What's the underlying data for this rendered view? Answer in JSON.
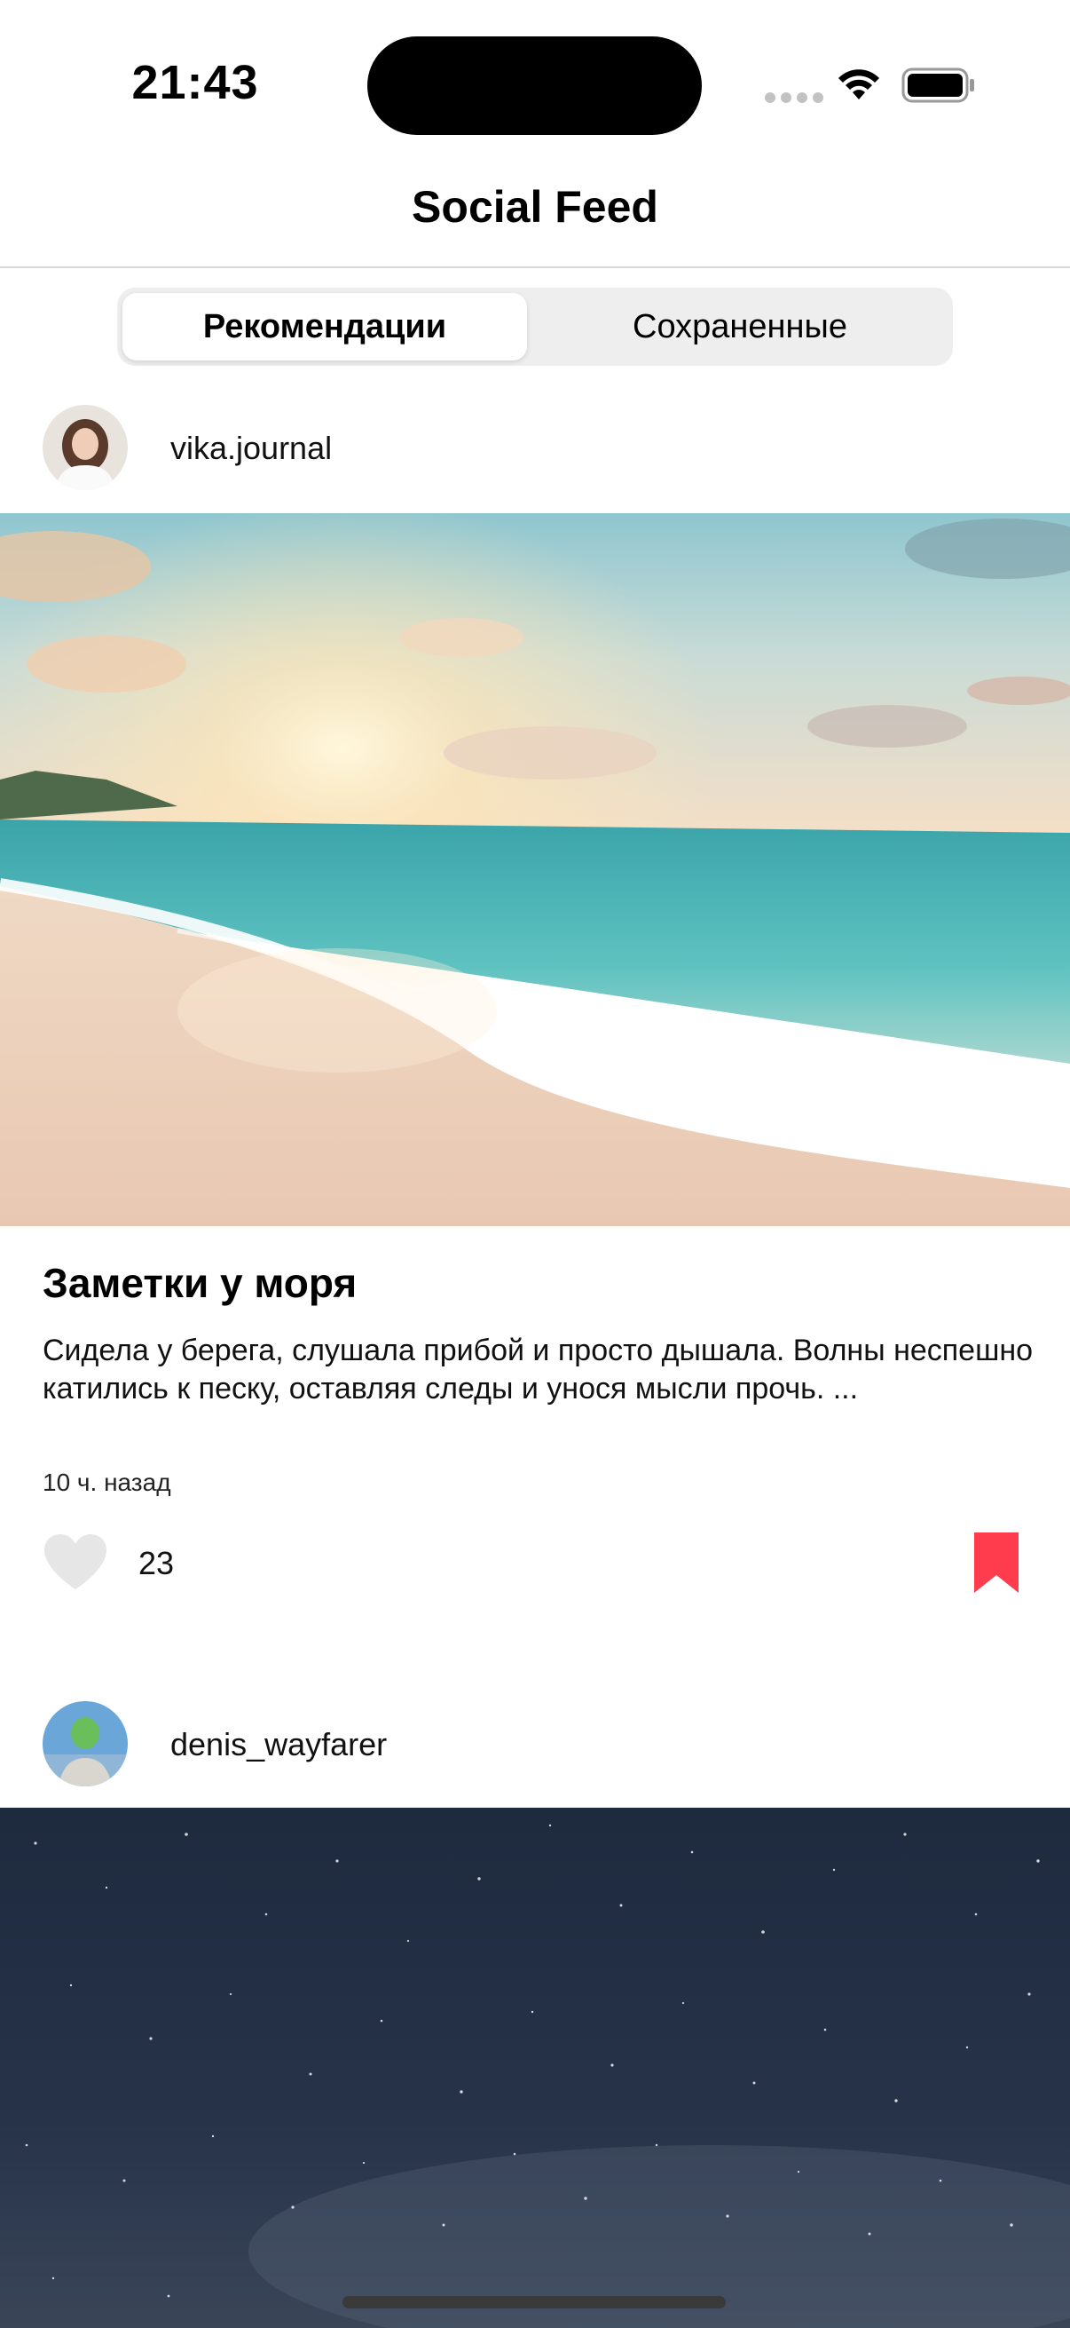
{
  "status_bar": {
    "time": "21:43"
  },
  "nav": {
    "title": "Social Feed"
  },
  "segments": {
    "recommended": "Рекомендации",
    "saved": "Сохраненные",
    "selected": "Рекомендации"
  },
  "posts": [
    {
      "username": "vika.journal",
      "title": "Заметки у моря",
      "text": "Сидела у берега, слушала прибой и просто дышала. Волны неспешно катились к песку, оставляя следы и унося мысли прочь. ...",
      "time": "10 ч. назад",
      "likes": "23",
      "liked": false,
      "saved": true
    },
    {
      "username": "denis_wayfarer"
    }
  ],
  "colors": {
    "bookmark_saved": "#ff3b4e",
    "heart_inactive": "#e6e6e6",
    "segment_bg": "#eeeeef"
  },
  "icons": {
    "wifi": "wifi-icon",
    "battery": "battery-icon",
    "like": "heart-icon",
    "save": "bookmark-icon"
  }
}
